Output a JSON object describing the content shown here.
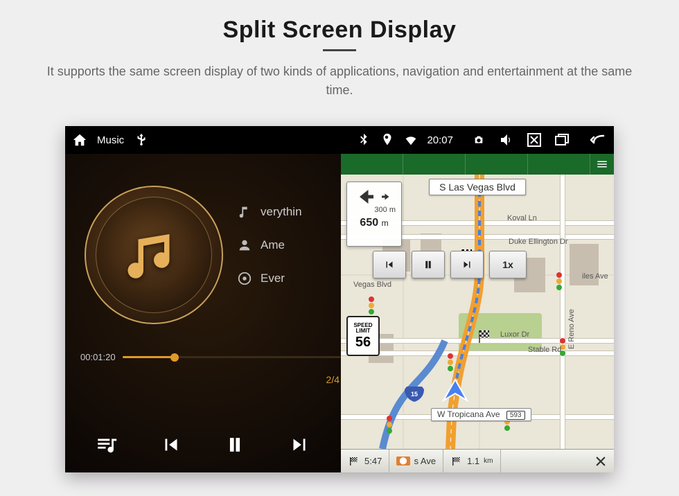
{
  "header": {
    "title": "Split Screen Display",
    "subtitle": "It supports the same screen display of two kinds of applications, navigation and entertainment at the same time."
  },
  "statusbar": {
    "app_label": "Music",
    "time": "20:07"
  },
  "music": {
    "tracks": [
      {
        "icon": "note",
        "label": "verythin"
      },
      {
        "icon": "person",
        "label": "Ame"
      },
      {
        "icon": "disc",
        "label": "Ever"
      }
    ],
    "counter": "2/4",
    "elapsed": "00:01:20",
    "progress_pct": 24
  },
  "nav": {
    "banner": "S Las Vegas Blvd",
    "turn": {
      "sub_dist": "300",
      "sub_unit": "m",
      "main_dist": "650",
      "main_unit": "m"
    },
    "speed_btn": "1x",
    "speed_limit": {
      "label1": "SPEED",
      "label2": "LIMIT",
      "value": "56"
    },
    "streets": {
      "koval": "Koval Ln",
      "duke": "Duke Ellington Dr",
      "vegas": "Vegas Blvd",
      "iles": "iles Ave",
      "luxor": "Luxor Dr",
      "stable": "Stable Rd",
      "reno": "E Reno Ave",
      "tropicana": "W Tropicana Ave",
      "shield15": "15",
      "shield593": "593"
    },
    "bottom": {
      "eta_time": "5:47",
      "eta_unit": "",
      "s_ave": "s Ave",
      "dist": "1.1",
      "dist_unit": "km"
    }
  }
}
